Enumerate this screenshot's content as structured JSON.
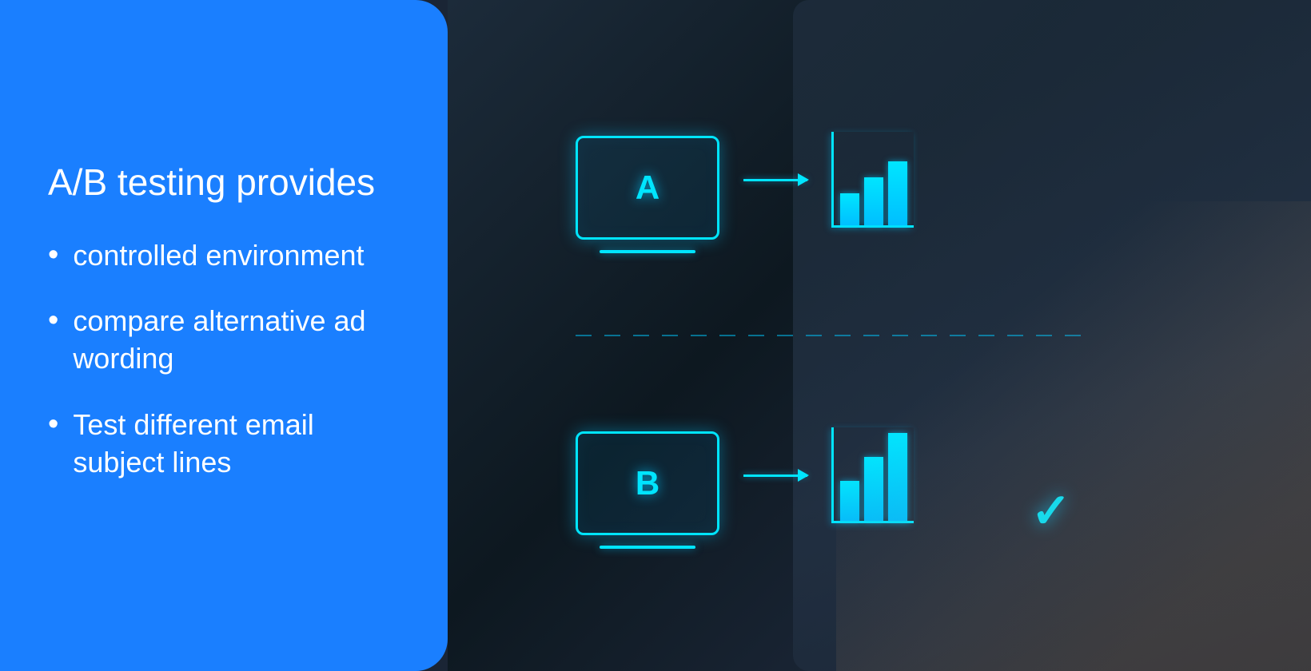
{
  "left_panel": {
    "heading": "A/B testing provides",
    "bullet_items": [
      {
        "bullet": "•",
        "text": "controlled environment"
      },
      {
        "bullet": "•",
        "text": "compare alternative ad wording"
      },
      {
        "bullet": "•",
        "text": "Test different email subject lines"
      }
    ]
  },
  "diagram": {
    "version_a_label": "A",
    "version_b_label": "B",
    "checkmark": "✓",
    "chart_a_bars": [
      40,
      60,
      80
    ],
    "chart_b_bars": [
      50,
      80,
      110
    ]
  },
  "colors": {
    "panel_bg": "#1a7fff",
    "text": "#ffffff",
    "accent": "#00e5ff",
    "dark_bg": "#1a2535"
  }
}
